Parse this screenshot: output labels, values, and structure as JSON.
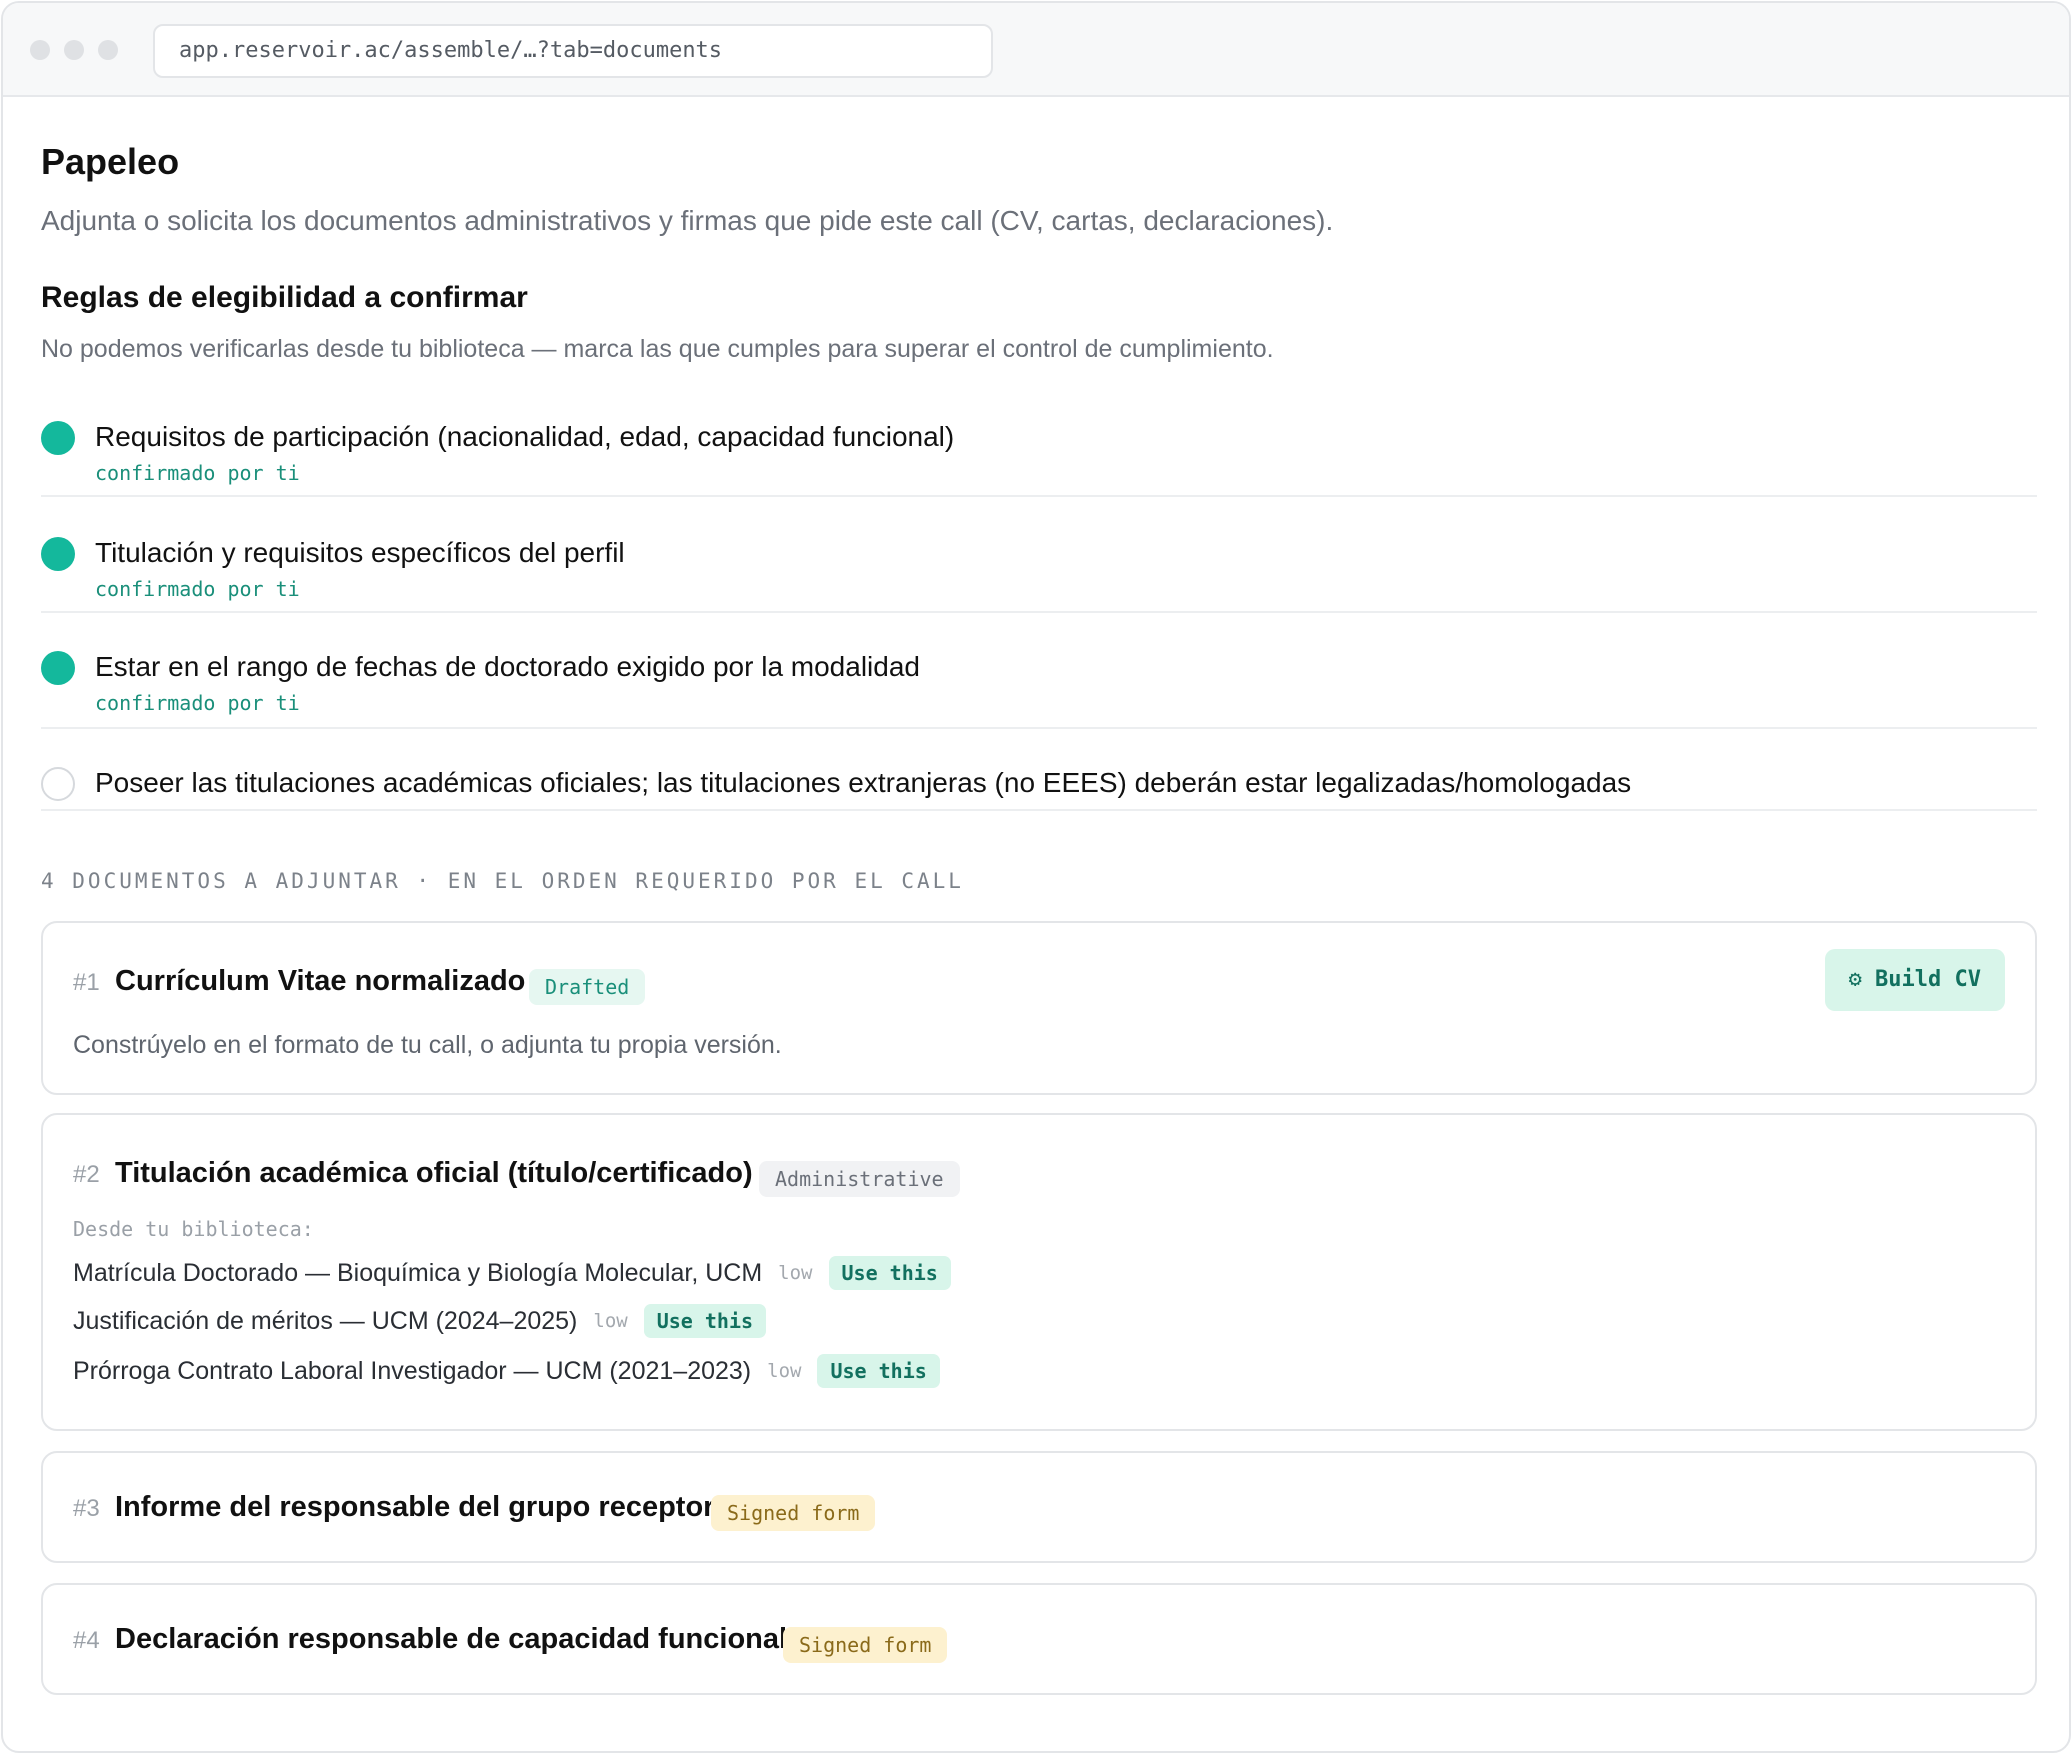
{
  "browser": {
    "url": "app.reservoir.ac/assemble/…?tab=documents"
  },
  "page": {
    "title": "Papeleo",
    "subtitle": "Adjunta o solicita los documentos administrativos y firmas que pide este call (CV, cartas, declaraciones)."
  },
  "rules": {
    "title": "Reglas de elegibilidad a confirmar",
    "subtitle": "No podemos verificarlas desde tu biblioteca — marca las que cumples para superar el control de cumplimiento.",
    "items": [
      {
        "label": "Requisitos de participación (nacionalidad, edad, capacidad funcional)",
        "status": "confirmado por ti",
        "checked": true
      },
      {
        "label": "Titulación y requisitos específicos del perfil",
        "status": "confirmado por ti",
        "checked": true
      },
      {
        "label": "Estar en el rango de fechas de doctorado exigido por la modalidad",
        "status": "confirmado por ti",
        "checked": true
      },
      {
        "label": "Poseer las titulaciones académicas oficiales; las titulaciones extranjeras (no EEES) deberán estar legalizadas/homologadas",
        "status": "",
        "checked": false
      }
    ]
  },
  "documents": {
    "heading": "4 DOCUMENTOS A ADJUNTAR · EN EL ORDEN REQUERIDO POR EL CALL",
    "items": [
      {
        "num": "#1",
        "title": "Currículum Vitae normalizado",
        "badge": "Drafted",
        "description": "Constrúyelo en el formato de tu call, o adjunta tu propia versión.",
        "action": "⚙ Build CV"
      },
      {
        "num": "#2",
        "title": "Titulación académica oficial (título/certificado)",
        "badge": "Administrative",
        "library_label": "Desde tu biblioteca:",
        "library": [
          {
            "name": "Matrícula Doctorado — Bioquímica y Biología Molecular, UCM",
            "confidence": "low",
            "action": "Use this"
          },
          {
            "name": "Justificación de méritos — UCM (2024–2025)",
            "confidence": "low",
            "action": "Use this"
          },
          {
            "name": "Prórroga Contrato Laboral Investigador — UCM (2021–2023)",
            "confidence": "low",
            "action": "Use this"
          }
        ]
      },
      {
        "num": "#3",
        "title": "Informe del responsable del grupo receptor",
        "badge": "Signed form"
      },
      {
        "num": "#4",
        "title": "Declaración responsable de capacidad funcional",
        "badge": "Signed form"
      }
    ]
  },
  "colors": {
    "accent": "#14b89c",
    "accent_dark": "#12705f",
    "signed": "#fdf1cf"
  }
}
